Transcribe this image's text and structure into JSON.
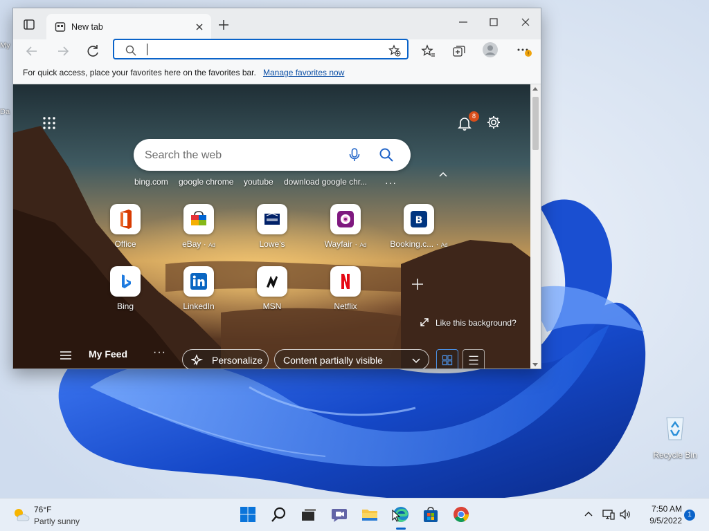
{
  "desktop": {
    "icon_stubs": [
      "My",
      "Da"
    ],
    "recycle_bin_label": "Recycle Bin"
  },
  "browser": {
    "tab": {
      "title": "New tab"
    },
    "address_bar": {
      "value": ""
    },
    "favorites_bar": {
      "message": "For quick access, place your favorites here on the favorites bar.",
      "link": "Manage favorites now"
    },
    "ntp": {
      "notification_count": "8",
      "search_placeholder": "Search the web",
      "suggestions": [
        "bing.com",
        "google chrome",
        "youtube",
        "download google chr..."
      ],
      "tiles_row1": [
        {
          "label": "Office",
          "ad": ""
        },
        {
          "label": "eBay",
          "ad": "Ad"
        },
        {
          "label": "Lowe's",
          "ad": ""
        },
        {
          "label": "Wayfair",
          "ad": "Ad"
        },
        {
          "label": "Booking.c...",
          "ad": "Ad"
        }
      ],
      "tiles_row2": [
        {
          "label": "Bing",
          "ad": ""
        },
        {
          "label": "LinkedIn",
          "ad": ""
        },
        {
          "label": "MSN",
          "ad": ""
        },
        {
          "label": "Netflix",
          "ad": ""
        }
      ],
      "like_background": "Like this background?",
      "feed": {
        "title": "My Feed",
        "personalize": "Personalize",
        "content_visibility": "Content partially visible"
      }
    }
  },
  "taskbar": {
    "weather": {
      "temp": "76°F",
      "condition": "Partly sunny"
    },
    "clock": {
      "time": "7:50 AM",
      "date": "9/5/2022"
    },
    "notification_count": "1"
  },
  "colors": {
    "accent": "#0a63c9",
    "badge_orange": "#d94e1a",
    "taskbar_bg": "#e7eef7"
  }
}
